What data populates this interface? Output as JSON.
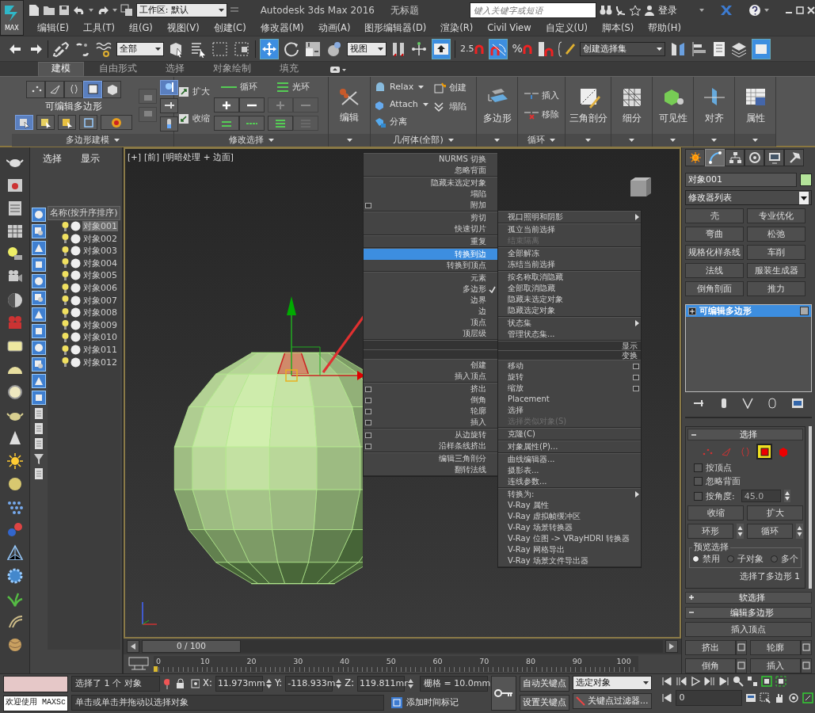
{
  "title_bar": {
    "logo_label": "MAX",
    "workspace": "工作区: 默认",
    "title": "Autodesk 3ds Max 2016",
    "document": "无标题",
    "search_placeholder": "键入关键字或短语",
    "sign_in": "登录"
  },
  "menu_bar": [
    "编辑(E)",
    "工具(T)",
    "组(G)",
    "视图(V)",
    "创建(C)",
    "修改器(M)",
    "动画(A)",
    "图形编辑器(D)",
    "渲染(R)",
    "Civil View",
    "自定义(U)",
    "脚本(S)",
    "帮助(H)"
  ],
  "main_toolbar": {
    "selection_filter": "全部",
    "reference_coord": "视图",
    "snap": "2.5",
    "percent_snap": "%",
    "named_selection": "创建选择集"
  },
  "ribbon": {
    "tabs": [
      {
        "label": "建模",
        "selected": true
      },
      {
        "label": "自由形式",
        "selected": false
      },
      {
        "label": "选择",
        "selected": false
      },
      {
        "label": "对象绘制",
        "selected": false
      },
      {
        "label": "填充",
        "selected": false
      }
    ],
    "polygon_modeling": {
      "modes": [
        {
          "selected": false
        },
        {
          "selected": false
        },
        {
          "selected": false
        },
        {
          "selected": true
        },
        {
          "selected": false
        }
      ],
      "object_type": "可编辑多边形",
      "footer": "多边形建模"
    },
    "modify_selection": {
      "grow": "扩大",
      "shrink": "收缩",
      "loop": "循环",
      "ring": "光环",
      "footer": "修改选择"
    },
    "edit": {
      "label": "编辑"
    },
    "geometry": {
      "left": [
        {
          "label": "Relax",
          "has_menu": true
        },
        {
          "label": "Attach",
          "has_menu": true
        },
        {
          "label": "分离",
          "has_menu": false
        }
      ],
      "right": [
        "创建",
        "塌陷"
      ],
      "footer": "几何体(全部)"
    },
    "tools": [
      {
        "kind": "large",
        "label": "多边形"
      },
      {
        "kind": "loops",
        "items": [
          "插入",
          "移除"
        ],
        "footer": "循环"
      },
      {
        "kind": "large",
        "label": "三角剖分"
      },
      {
        "kind": "large",
        "label": "细分"
      },
      {
        "kind": "large",
        "label": "可见性"
      },
      {
        "kind": "large",
        "label": "对齐"
      },
      {
        "kind": "large",
        "label": "属性"
      }
    ]
  },
  "scene_explorer": {
    "tabs": [
      "选择",
      "显示"
    ],
    "column_header": "名称(按升序排序)",
    "objects": [
      {
        "name": "对象001",
        "selected": true
      },
      {
        "name": "对象002",
        "selected": false
      },
      {
        "name": "对象003",
        "selected": false
      },
      {
        "name": "对象004",
        "selected": false
      },
      {
        "name": "对象005",
        "selected": false
      },
      {
        "name": "对象006",
        "selected": false
      },
      {
        "name": "对象007",
        "selected": false
      },
      {
        "name": "对象008",
        "selected": false
      },
      {
        "name": "对象009",
        "selected": false
      },
      {
        "name": "对象010",
        "selected": false
      },
      {
        "name": "对象011",
        "selected": false
      },
      {
        "name": "对象012",
        "selected": false
      }
    ]
  },
  "viewport": {
    "labels": [
      "[+]",
      "[前]",
      "[明暗处理 + 边面]"
    ],
    "time_slider": "0 / 100"
  },
  "quad_menu": {
    "left_upper": [
      [
        {
          "label": "NURMS 切换",
          "selected": false,
          "checked": false,
          "disabled": false,
          "options": false
        },
        {
          "label": "忽略背面",
          "selected": false,
          "checked": false,
          "disabled": false,
          "options": false
        }
      ],
      [
        {
          "label": "隐藏未选定对象",
          "selected": false,
          "checked": false,
          "disabled": false,
          "options": false
        },
        {
          "label": "塌陷",
          "selected": false,
          "checked": false,
          "disabled": false,
          "options": false
        },
        {
          "label": "附加",
          "selected": false,
          "checked": false,
          "disabled": false,
          "options": true
        }
      ],
      [
        {
          "label": "剪切",
          "selected": false,
          "checked": false,
          "disabled": false,
          "options": false
        },
        {
          "label": "快速切片",
          "selected": false,
          "checked": false,
          "disabled": false,
          "options": false
        }
      ],
      [
        {
          "label": "重复",
          "selected": false,
          "checked": false,
          "disabled": false,
          "options": false
        }
      ],
      [
        {
          "label": "转换到边",
          "selected": true,
          "checked": false,
          "disabled": false,
          "options": false
        },
        {
          "label": "转换到顶点",
          "selected": false,
          "checked": false,
          "disabled": false,
          "options": false
        }
      ],
      [
        {
          "label": "元素",
          "selected": false,
          "checked": false,
          "disabled": false,
          "options": false
        },
        {
          "label": "多边形",
          "selected": false,
          "checked": true,
          "disabled": false,
          "options": false
        },
        {
          "label": "边界",
          "selected": false,
          "checked": false,
          "disabled": false,
          "options": false
        },
        {
          "label": "边",
          "selected": false,
          "checked": false,
          "disabled": false,
          "options": false
        },
        {
          "label": "顶点",
          "selected": false,
          "checked": false,
          "disabled": false,
          "options": false
        },
        {
          "label": "顶层级",
          "selected": false,
          "checked": false,
          "disabled": false,
          "options": false
        }
      ]
    ],
    "left_lower": [
      [
        {
          "label": "创建",
          "selected": false,
          "checked": false,
          "disabled": false,
          "options": false
        },
        {
          "label": "插入顶点",
          "selected": false,
          "checked": false,
          "disabled": false,
          "options": false
        }
      ],
      [
        {
          "label": "挤出",
          "selected": false,
          "checked": false,
          "disabled": false,
          "options": true
        },
        {
          "label": "倒角",
          "selected": false,
          "checked": false,
          "disabled": false,
          "options": true
        },
        {
          "label": "轮廓",
          "selected": false,
          "checked": false,
          "disabled": false,
          "options": true
        },
        {
          "label": "插入",
          "selected": false,
          "checked": false,
          "disabled": false,
          "options": true
        }
      ],
      [
        {
          "label": "从边旋转",
          "selected": false,
          "checked": false,
          "disabled": false,
          "options": true
        },
        {
          "label": "沿样条线挤出",
          "selected": false,
          "checked": false,
          "disabled": false,
          "options": true
        }
      ],
      [
        {
          "label": "编辑三角剖分",
          "selected": false,
          "checked": false,
          "disabled": false,
          "options": false
        },
        {
          "label": "翻转法线",
          "selected": false,
          "checked": false,
          "disabled": false,
          "options": false
        }
      ]
    ],
    "right_upper": [
      [
        {
          "label": "视口照明和阴影",
          "selected": false,
          "disabled": false,
          "options": false,
          "submenu": true
        }
      ],
      [
        {
          "label": "孤立当前选择",
          "selected": false,
          "disabled": false,
          "options": false,
          "submenu": false
        },
        {
          "label": "结束隔离",
          "selected": false,
          "disabled": true,
          "options": false,
          "submenu": false
        }
      ],
      [
        {
          "label": "全部解冻",
          "selected": false,
          "disabled": false,
          "options": false,
          "submenu": false
        },
        {
          "label": "冻结当前选择",
          "selected": false,
          "disabled": false,
          "options": false,
          "submenu": false
        }
      ],
      [
        {
          "label": "按名称取消隐藏",
          "selected": false,
          "disabled": false,
          "options": false,
          "submenu": false
        },
        {
          "label": "全部取消隐藏",
          "selected": false,
          "disabled": false,
          "options": false,
          "submenu": false
        },
        {
          "label": "隐藏未选定对象",
          "selected": false,
          "disabled": false,
          "options": false,
          "submenu": false
        },
        {
          "label": "隐藏选定对象",
          "selected": false,
          "disabled": false,
          "options": false,
          "submenu": false
        }
      ],
      [
        {
          "label": "状态集",
          "selected": false,
          "disabled": false,
          "options": false,
          "submenu": true
        },
        {
          "label": "管理状态集...",
          "selected": false,
          "disabled": false,
          "options": false,
          "submenu": false
        }
      ]
    ],
    "right_headers": [
      "显示",
      "变换"
    ],
    "right_lower": [
      [
        {
          "label": "移动",
          "selected": false,
          "disabled": false,
          "options": true,
          "submenu": false
        },
        {
          "label": "旋转",
          "selected": false,
          "disabled": false,
          "options": true,
          "submenu": false
        },
        {
          "label": "缩放",
          "selected": false,
          "disabled": false,
          "options": true,
          "submenu": false
        },
        {
          "label": "Placement",
          "selected": false,
          "disabled": false,
          "options": false,
          "submenu": false
        },
        {
          "label": "选择",
          "selected": false,
          "disabled": false,
          "options": false,
          "submenu": false
        },
        {
          "label": "选择类似对象(S)",
          "selected": false,
          "disabled": true,
          "options": false,
          "submenu": false
        }
      ],
      [
        {
          "label": "克隆(C)",
          "selected": false,
          "disabled": false,
          "options": false,
          "submenu": false
        }
      ],
      [
        {
          "label": "对象属性(P)...",
          "selected": false,
          "disabled": false,
          "options": false,
          "submenu": false
        }
      ],
      [
        {
          "label": "曲线编辑器...",
          "selected": false,
          "disabled": false,
          "options": false,
          "submenu": false
        },
        {
          "label": "摄影表...",
          "selected": false,
          "disabled": false,
          "options": false,
          "submenu": false
        },
        {
          "label": "连线参数...",
          "selected": false,
          "disabled": false,
          "options": false,
          "submenu": false
        }
      ],
      [
        {
          "label": "转换为:",
          "selected": false,
          "disabled": false,
          "options": false,
          "submenu": true
        },
        {
          "label": "V-Ray 属性",
          "selected": false,
          "disabled": false,
          "options": false,
          "submenu": false
        },
        {
          "label": "V-Ray 虚拟帧缓冲区",
          "selected": false,
          "disabled": false,
          "options": false,
          "submenu": false
        },
        {
          "label": "V-Ray 场景转换器",
          "selected": false,
          "disabled": false,
          "options": false,
          "submenu": false
        },
        {
          "label": "V-Ray 位图 -> VRayHDRI 转换器",
          "selected": false,
          "disabled": false,
          "options": false,
          "submenu": false
        },
        {
          "label": "V-Ray 网格导出",
          "selected": false,
          "disabled": false,
          "options": false,
          "submenu": false
        },
        {
          "label": "V-Ray 场景文件导出器",
          "selected": false,
          "disabled": false,
          "options": false,
          "submenu": false
        }
      ]
    ]
  },
  "command_panel": {
    "tabs": [
      {
        "selected": false
      },
      {
        "selected": true
      },
      {
        "selected": false
      },
      {
        "selected": false
      },
      {
        "selected": false
      },
      {
        "selected": false
      }
    ],
    "object_name": "对象001",
    "modifier_list": "修改器列表",
    "modifier_buttons": [
      "壳",
      "专业优化",
      "弯曲",
      "松弛",
      "规格化样条线",
      "车削",
      "法线",
      "服装生成器",
      "倒角剖面",
      "推力"
    ],
    "stack": [
      {
        "label": "可编辑多边形",
        "selected": true
      }
    ],
    "selection": {
      "title": "选择",
      "expanded": true,
      "modes": [
        {
          "selected": false
        },
        {
          "selected": false
        },
        {
          "selected": false
        },
        {
          "selected": true
        },
        {
          "selected": false
        }
      ],
      "options": [
        {
          "label": "按顶点",
          "checked": false
        },
        {
          "label": "忽略背面",
          "checked": false
        },
        {
          "label": "按角度:",
          "checked": false
        }
      ],
      "angle": "45.0",
      "shrink": "收缩",
      "grow": "扩大",
      "ring": "环形",
      "loop": "循环",
      "preview_title": "预览选择",
      "preview": [
        {
          "label": "禁用",
          "selected": true
        },
        {
          "label": "子对象",
          "selected": false
        },
        {
          "label": "多个",
          "selected": false
        }
      ],
      "summary": "选择了多边形 1"
    },
    "rollouts": [
      {
        "title": "软选择",
        "expanded": false
      },
      {
        "title": "编辑多边形",
        "expanded": true
      }
    ],
    "edit_polygons": {
      "insert_vertex": "插入顶点",
      "buttons": [
        "挤出",
        "轮廓",
        "倒角",
        "插入"
      ]
    }
  },
  "track_bar": {
    "labels": [
      "0",
      "10",
      "20",
      "30",
      "40",
      "50",
      "60",
      "70",
      "80",
      "90",
      "100"
    ]
  },
  "status_bar": {
    "welcome": "欢迎使用 MAXSc",
    "selection": "选择了 1 个 对象",
    "prompt": "单击或单击并拖动以选择对象",
    "coords": [
      {
        "axis": "X:",
        "value": "11.973mm"
      },
      {
        "axis": "Y:",
        "value": "-118.933m"
      },
      {
        "axis": "Z:",
        "value": "119.811mr"
      }
    ],
    "grid": "栅格 = 10.0mm",
    "add_time_tag": "添加时间标记",
    "auto_key": "自动关键点",
    "key_mode": "选定对象",
    "set_key": "设置关键点",
    "key_filters": "关键点过滤器...",
    "frame": "0"
  }
}
